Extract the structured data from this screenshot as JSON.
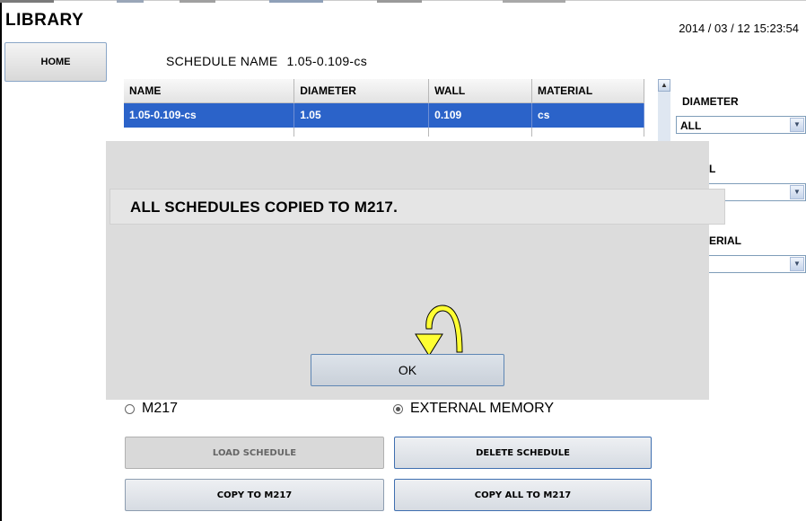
{
  "header": {
    "title": "LIBRARY",
    "datetime": "2014 / 03 / 12   15:23:54"
  },
  "nav": {
    "home_label": "HOME"
  },
  "schedule": {
    "label": "SCHEDULE NAME",
    "value": "1.05-0.109-cs"
  },
  "table": {
    "columns": [
      "NAME",
      "DIAMETER",
      "WALL",
      "MATERIAL"
    ],
    "rows": [
      [
        "1.05-0.109-cs",
        "1.05",
        "0.109",
        "cs"
      ]
    ]
  },
  "filters": {
    "diameter_label": "DIAMETER",
    "diameter_value": "ALL",
    "wall_label_visible": "L",
    "material_label_visible": "ERIAL"
  },
  "dialog": {
    "message": "ALL SCHEDULES COPIED TO M217.",
    "ok_label": "OK"
  },
  "memory": {
    "option_m217": "M217",
    "option_external": "EXTERNAL MEMORY",
    "selected": "EXTERNAL MEMORY"
  },
  "actions": {
    "load": "LOAD SCHEDULE",
    "delete": "DELETE SCHEDULE",
    "copy": "COPY TO M217",
    "copy_all": "COPY ALL TO M217"
  },
  "colors": {
    "selection": "#2b63c9",
    "cursor_fill": "#ffff33"
  }
}
